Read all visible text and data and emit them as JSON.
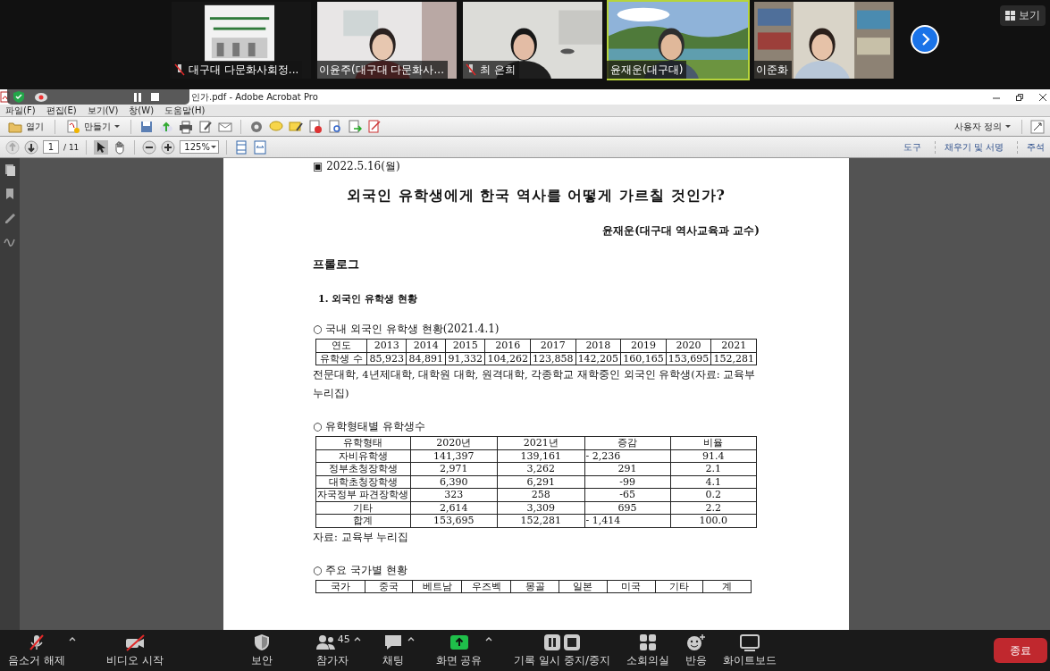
{
  "meeting": {
    "participants": [
      {
        "name": "대구대 다문화사회정...",
        "muted": true,
        "speaking": false
      },
      {
        "name": "이윤주(대구대 다문화사...",
        "muted": false,
        "speaking": false
      },
      {
        "name": "최 은희",
        "muted": true,
        "speaking": false
      },
      {
        "name": "윤재운(대구대)",
        "muted": false,
        "speaking": true
      },
      {
        "name": "이준화",
        "muted": false,
        "speaking": false
      }
    ],
    "view_button": "보기"
  },
  "acrobat": {
    "title": "인가.pdf - Adobe Acrobat Pro",
    "menu": [
      "파일(F)",
      "편집(E)",
      "보기(V)",
      "창(W)",
      "도움말(H)"
    ],
    "open": "열기",
    "create": "만들기",
    "customize": "사용자 정의",
    "page_number": "1",
    "page_total": "/ 11",
    "zoom": "125%",
    "panes": [
      "도구",
      "채우기 및 서명",
      "주석"
    ]
  },
  "document": {
    "date": "▣ 2022.5.16(월)",
    "title": "외국인 유학생에게 한국 역사를 어떻게 가르칠 것인가?",
    "author": "윤재운(대구대 역사교육과 교수)",
    "heading": "프롤로그",
    "section": "1. 외국인 유학생 현황",
    "blocks": [
      {
        "kind": "bullet",
        "text": "○ 국내 외국인 유학생 현황(2021.4.1)"
      },
      {
        "kind": "table",
        "rows": [
          [
            "연도",
            "2013",
            "2014",
            "2015",
            "2016",
            "2017",
            "2018",
            "2019",
            "2020",
            "2021"
          ],
          [
            "유학생 수",
            "85,923",
            "84,891",
            "91,332",
            "104,262",
            "123,858",
            "142,205",
            "160,165",
            "153,695",
            "152,281"
          ]
        ]
      },
      {
        "kind": "note",
        "text": "전문대학, 4년제대학, 대학원 대학, 원격대학, 각종학교 재학중인 외국인 유학생(자료: 교육부 누리집)"
      },
      {
        "kind": "bullet",
        "text": "○ 유학형태별 유학생수"
      },
      {
        "kind": "table",
        "rows": [
          [
            "유학형태",
            "2020년",
            "2021년",
            "증감",
            "비율"
          ],
          [
            "자비유학생",
            "141,397",
            "139,161",
            "- 2,236",
            "91.4"
          ],
          [
            "정부초청장학생",
            "2,971",
            "3,262",
            "291",
            "2.1"
          ],
          [
            "대학초청장학생",
            "6,390",
            "6,291",
            "-99",
            "4.1"
          ],
          [
            "자국정부 파견장학생",
            "323",
            "258",
            "-65",
            "0.2"
          ],
          [
            "기타",
            "2,614",
            "3,309",
            "695",
            "2.2"
          ],
          [
            "합계",
            "153,695",
            "152,281",
            "- 1,414",
            "100.0"
          ]
        ]
      },
      {
        "kind": "note",
        "text": "자료: 교육부 누리집"
      },
      {
        "kind": "bullet",
        "text": "○ 주요 국가별 현황"
      },
      {
        "kind": "table",
        "rows": [
          [
            "국가",
            "중국",
            "베트남",
            "우즈벡",
            "몽골",
            "일본",
            "미국",
            "기타",
            "계"
          ]
        ]
      }
    ]
  },
  "controls": [
    {
      "label": "음소거 해제",
      "kind": "mic",
      "menu": true
    },
    {
      "label": "비디오 시작",
      "kind": "video",
      "menu": false
    },
    {
      "label": "보안",
      "kind": "shield",
      "menu": false
    },
    {
      "label": "참가자",
      "kind": "people",
      "count": "45",
      "menu": true
    },
    {
      "label": "채팅",
      "kind": "chat",
      "menu": true
    },
    {
      "label": "화면 공유",
      "kind": "share",
      "menu": true
    },
    {
      "label": "기록 일시 중지/중지",
      "kind": "record",
      "menu": false
    },
    {
      "label": "소회의실",
      "kind": "rooms",
      "menu": false
    },
    {
      "label": "반응",
      "kind": "react",
      "menu": false
    },
    {
      "label": "화이트보드",
      "kind": "board",
      "menu": false
    }
  ],
  "end_button": "종료"
}
